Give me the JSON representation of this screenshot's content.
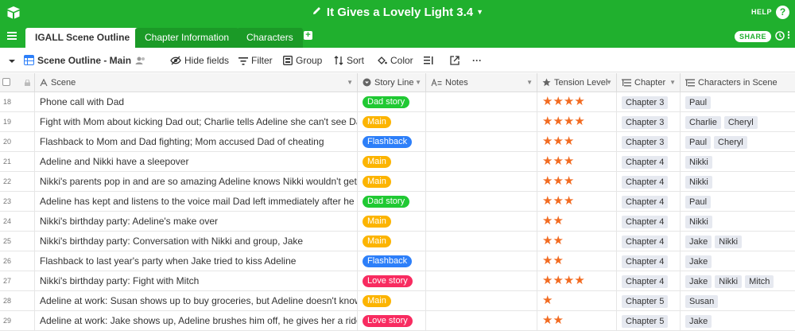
{
  "app": {
    "base_title": "It Gives a Lovely Light 3.4",
    "help_label": "HELP",
    "help_icon": "?",
    "share_label": "SHARE",
    "brand_color": "#20b02e"
  },
  "tabs": [
    {
      "label": "IGALL Scene Outline",
      "active": true
    },
    {
      "label": "Chapter Information",
      "active": false
    },
    {
      "label": "Characters",
      "active": false
    }
  ],
  "toolbar": {
    "view_name": "Scene Outline - Main",
    "hide_fields": "Hide fields",
    "filter": "Filter",
    "group": "Group",
    "sort": "Sort",
    "color": "Color",
    "more": "···"
  },
  "columns": {
    "scene": "Scene",
    "story_line": "Story Line",
    "notes": "Notes",
    "tension": "Tension Level",
    "chapter": "Chapter",
    "characters": "Characters in Scene"
  },
  "story_colors": {
    "Dad story": "#20c933",
    "Main": "#fcb400",
    "Flashback": "#2d7ff9",
    "Love story": "#f82b60"
  },
  "rows": [
    {
      "num": "18",
      "scene": "Phone call with Dad",
      "story": "Dad story",
      "tension": 4,
      "chapter": "Chapter 3",
      "characters": [
        "Paul"
      ]
    },
    {
      "num": "19",
      "scene": "Fight with Mom about kicking Dad out; Charlie tells Adeline she can't see Dad",
      "story": "Main",
      "tension": 4,
      "chapter": "Chapter 3",
      "characters": [
        "Charlie",
        "Cheryl"
      ]
    },
    {
      "num": "20",
      "scene": "Flashback to Mom and Dad fighting; Mom accused Dad of cheating",
      "story": "Flashback",
      "tension": 3,
      "chapter": "Chapter 3",
      "characters": [
        "Paul",
        "Cheryl"
      ]
    },
    {
      "num": "21",
      "scene": "Adeline and Nikki have a sleepover",
      "story": "Main",
      "tension": 3,
      "chapter": "Chapter 4",
      "characters": [
        "Nikki"
      ]
    },
    {
      "num": "22",
      "scene": "Nikki's parents pop in and are so amazing Adeline knows Nikki wouldn't get it",
      "story": "Main",
      "tension": 3,
      "chapter": "Chapter 4",
      "characters": [
        "Nikki"
      ]
    },
    {
      "num": "23",
      "scene": "Adeline has kept and listens to the voice mail Dad left immediately after he left",
      "story": "Dad story",
      "tension": 3,
      "chapter": "Chapter 4",
      "characters": [
        "Paul"
      ]
    },
    {
      "num": "24",
      "scene": "Nikki's birthday party: Adeline's make over",
      "story": "Main",
      "tension": 2,
      "chapter": "Chapter 4",
      "characters": [
        "Nikki"
      ]
    },
    {
      "num": "25",
      "scene": "Nikki's birthday party: Conversation with Nikki and group, Jake",
      "story": "Main",
      "tension": 2,
      "chapter": "Chapter 4",
      "characters": [
        "Jake",
        "Nikki"
      ]
    },
    {
      "num": "26",
      "scene": "Flashback to last year's party when Jake tried to kiss Adeline",
      "story": "Flashback",
      "tension": 2,
      "chapter": "Chapter 4",
      "characters": [
        "Jake"
      ]
    },
    {
      "num": "27",
      "scene": "Nikki's birthday party: Fight with Mitch",
      "story": "Love story",
      "tension": 4,
      "chapter": "Chapter 4",
      "characters": [
        "Jake",
        "Nikki",
        "Mitch"
      ]
    },
    {
      "num": "28",
      "scene": "Adeline at work: Susan shows up to buy groceries, but Adeline doesn't know who it is",
      "story": "Main",
      "tension": 1,
      "chapter": "Chapter 5",
      "characters": [
        "Susan"
      ]
    },
    {
      "num": "29",
      "scene": "Adeline at work: Jake shows up, Adeline brushes him off, he gives her a ride home",
      "story": "Love story",
      "tension": 2,
      "chapter": "Chapter 5",
      "characters": [
        "Jake"
      ]
    }
  ]
}
